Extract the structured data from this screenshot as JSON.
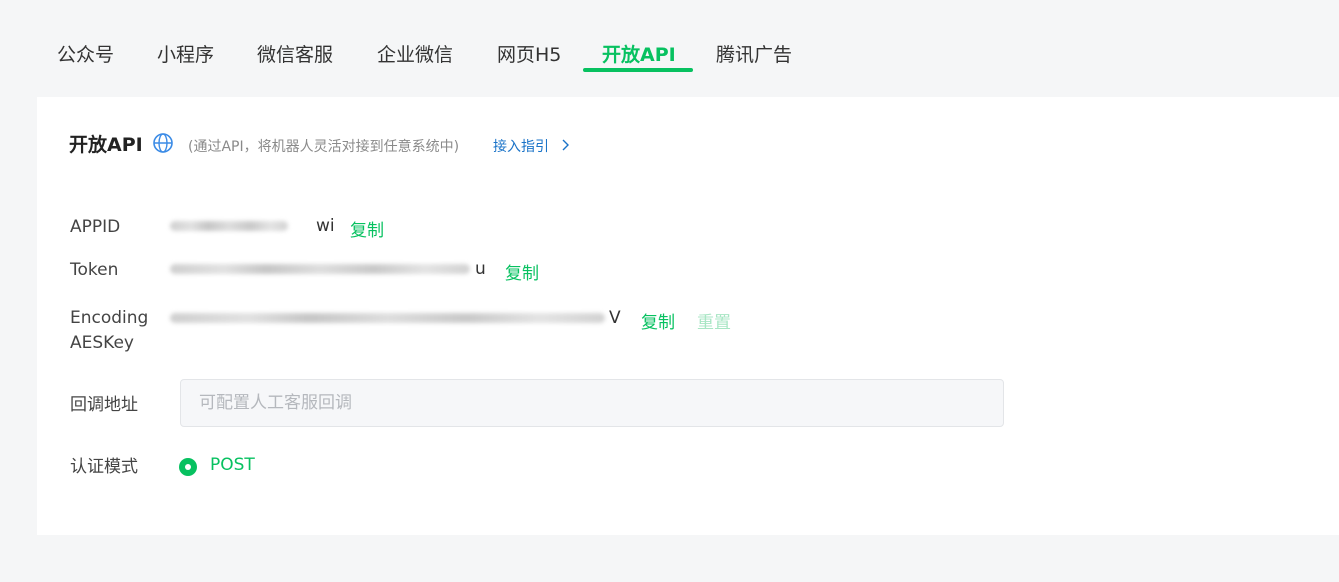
{
  "tabs": [
    {
      "label": "公众号"
    },
    {
      "label": "小程序"
    },
    {
      "label": "微信客服"
    },
    {
      "label": "企业微信"
    },
    {
      "label": "网页H5"
    },
    {
      "label": "开放API"
    },
    {
      "label": "腾讯广告"
    }
  ],
  "active_tab": "开放API",
  "panel": {
    "title": "开放API",
    "description": "(通过API，将机器人灵活对接到任意系统中)",
    "guide_link": "接入指引"
  },
  "fields": {
    "appid": {
      "label": "APPID",
      "visible_tail": "wi",
      "copy": "复制"
    },
    "token": {
      "label": "Token",
      "visible_tail": "u",
      "copy": "复制"
    },
    "aeskey": {
      "label_line1": "Encoding",
      "label_line2": "AESKey",
      "visible_tail": "V",
      "copy": "复制",
      "reset": "重置"
    },
    "callback": {
      "label": "回调地址",
      "value": "",
      "placeholder": "可配置人工客服回调"
    },
    "auth_mode": {
      "label": "认证模式",
      "option": "POST",
      "selected": true
    }
  },
  "colors": {
    "accent": "#07c160",
    "link": "#1a73c8",
    "disabled_accent": "#a8e6c4",
    "page_bg": "#f5f6f7",
    "panel_bg": "#ffffff"
  },
  "icons": {
    "title_icon": "globe-icon",
    "link_icon": "chevron-right-icon"
  }
}
